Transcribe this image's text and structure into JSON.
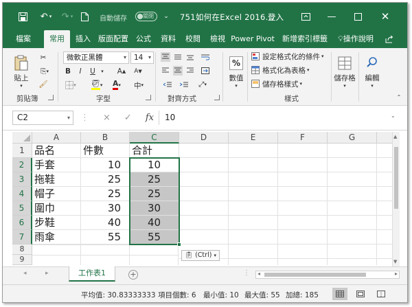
{
  "titlebar": {
    "autosave_label": "自動儲存",
    "autosave_state": "關閉",
    "title": "751如何在Excel 2016...",
    "login": "登入"
  },
  "tabs": [
    {
      "label": "檔案"
    },
    {
      "label": "常用",
      "active": true
    },
    {
      "label": "插入"
    },
    {
      "label": "版面配置"
    },
    {
      "label": "公式"
    },
    {
      "label": "資料"
    },
    {
      "label": "校閱"
    },
    {
      "label": "檢視"
    },
    {
      "label": "Power Pivot"
    },
    {
      "label": "新增索引標籤"
    },
    {
      "label": "操作說明"
    }
  ],
  "ribbon": {
    "paste_label": "貼上",
    "clipboard_label": "剪貼簿",
    "font_name": "微軟正黑體",
    "font_size": "14",
    "font_group_label": "字型",
    "bold": "B",
    "italic": "I",
    "underline": "U",
    "grow_font": "A",
    "shrink_font": "A",
    "zh_phonetic": "中",
    "alignment_label": "對齊方式",
    "number_label": "數值",
    "number_symbol": "%",
    "cond_format": "設定格式化的條件",
    "format_table": "格式化為表格",
    "cell_styles": "儲存格樣式",
    "styles_label": "樣式",
    "cells_label": "儲存格",
    "editing_label": "編輯"
  },
  "formula_bar": {
    "name_box": "C2",
    "cancel": "×",
    "enter": "✓",
    "fx": "fx",
    "value": "10"
  },
  "grid": {
    "columns": [
      "A",
      "B",
      "C",
      "D",
      "E",
      "F",
      "G"
    ],
    "rows": [
      "1",
      "2",
      "3",
      "4",
      "5",
      "6",
      "7",
      "8",
      "9"
    ],
    "data": [
      [
        "品名",
        "件數",
        "合計"
      ],
      [
        "手套",
        "10",
        "10"
      ],
      [
        "拖鞋",
        "25",
        "25"
      ],
      [
        "帽子",
        "25",
        "25"
      ],
      [
        "圍巾",
        "30",
        "30"
      ],
      [
        "步鞋",
        "40",
        "40"
      ],
      [
        "雨傘",
        "55",
        "55"
      ]
    ],
    "paste_options": "(Ctrl)"
  },
  "sheets": {
    "active": "工作表1",
    "add": "+"
  },
  "status": {
    "average": "平均值: 30.83333333",
    "count": "項目個數: 6",
    "min": "最小值: 10",
    "max": "最大值: 55",
    "sum": "加總: 185"
  },
  "colors": {
    "accent": "#217346",
    "selection_fill": "#c6c6c6"
  }
}
